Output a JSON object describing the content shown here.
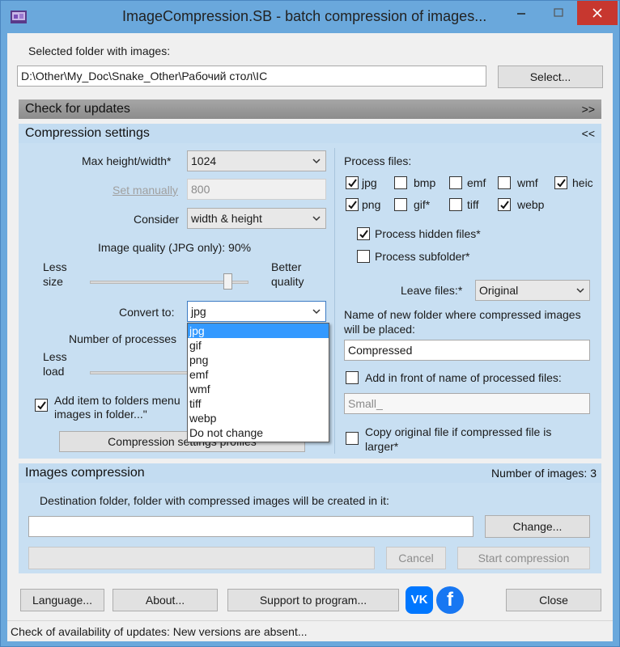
{
  "window": {
    "title": "ImageCompression.SB - batch compression of images..."
  },
  "folder": {
    "label": "Selected folder with images:",
    "path": "D:\\Other\\My_Doc\\Snake_Other\\Рабочий стол\\IC",
    "select_button": "Select..."
  },
  "updates_panel": {
    "title": "Check for updates",
    "toggle": ">>"
  },
  "compression_panel": {
    "title": "Compression settings",
    "toggle": "<<",
    "max_size": {
      "label": "Max height/width*",
      "value": "1024"
    },
    "set_manually": {
      "label": "Set manually",
      "value": "800"
    },
    "consider": {
      "label": "Consider",
      "value": "width & height"
    },
    "quality": {
      "label": "Image quality (JPG only): 90%",
      "left_label": "Less\nsize",
      "right_label": "Better\nquality",
      "value": 90
    },
    "convert_to": {
      "label": "Convert to:",
      "value": "jpg",
      "options": [
        "jpg",
        "gif",
        "png",
        "emf",
        "wmf",
        "tiff",
        "webp",
        "Do not change"
      ]
    },
    "processes": {
      "label": "Number of processes",
      "left_label": "Less\nload"
    },
    "add_item": {
      "label_line1": "Add item to folders menu",
      "label_line2": "images in folder...\"",
      "checked": true
    },
    "profiles_button": "Compression settings profiles",
    "process_files": {
      "label": "Process files:",
      "types": [
        {
          "name": "jpg",
          "checked": true
        },
        {
          "name": "bmp",
          "checked": false
        },
        {
          "name": "emf",
          "checked": false
        },
        {
          "name": "wmf",
          "checked": false
        },
        {
          "name": "heic",
          "checked": true
        },
        {
          "name": "png",
          "checked": true
        },
        {
          "name": "gif*",
          "checked": false
        },
        {
          "name": "tiff",
          "checked": false
        },
        {
          "name": "webp",
          "checked": true
        }
      ]
    },
    "hidden_files": {
      "label": "Process hidden files*",
      "checked": true
    },
    "subfolders": {
      "label": "Process subfolder*",
      "checked": false
    },
    "leave_files": {
      "label": "Leave files:*",
      "value": "Original"
    },
    "new_folder": {
      "label_line1": "Name of new folder where compressed images",
      "label_line2": "will be placed:",
      "value": "Compressed"
    },
    "add_front": {
      "label": "Add in front of name of processed files:",
      "checked": false,
      "placeholder": "Small_"
    },
    "copy_original": {
      "label_line1": "Copy original file if compressed file is",
      "label_line2": "larger*",
      "checked": false
    }
  },
  "images_panel": {
    "title": "Images compression",
    "count_label": "Number of images: 3",
    "destination_label": "Destination folder, folder with compressed images will be created in it:",
    "destination_value": "",
    "change_button": "Change...",
    "cancel_button": "Cancel",
    "start_button": "Start compression"
  },
  "footer": {
    "language_button": "Language...",
    "about_button": "About...",
    "support_button": "Support to program...",
    "close_button": "Close",
    "vk_label": "VK",
    "fb_label": "f"
  },
  "status": {
    "text": "Check of availability of updates: New versions are absent..."
  },
  "colors": {
    "accent": "#6aa8dc",
    "panel": "#c8dff2",
    "highlight": "#3399ff",
    "vk": "#0077ff",
    "facebook": "#1877f2"
  }
}
